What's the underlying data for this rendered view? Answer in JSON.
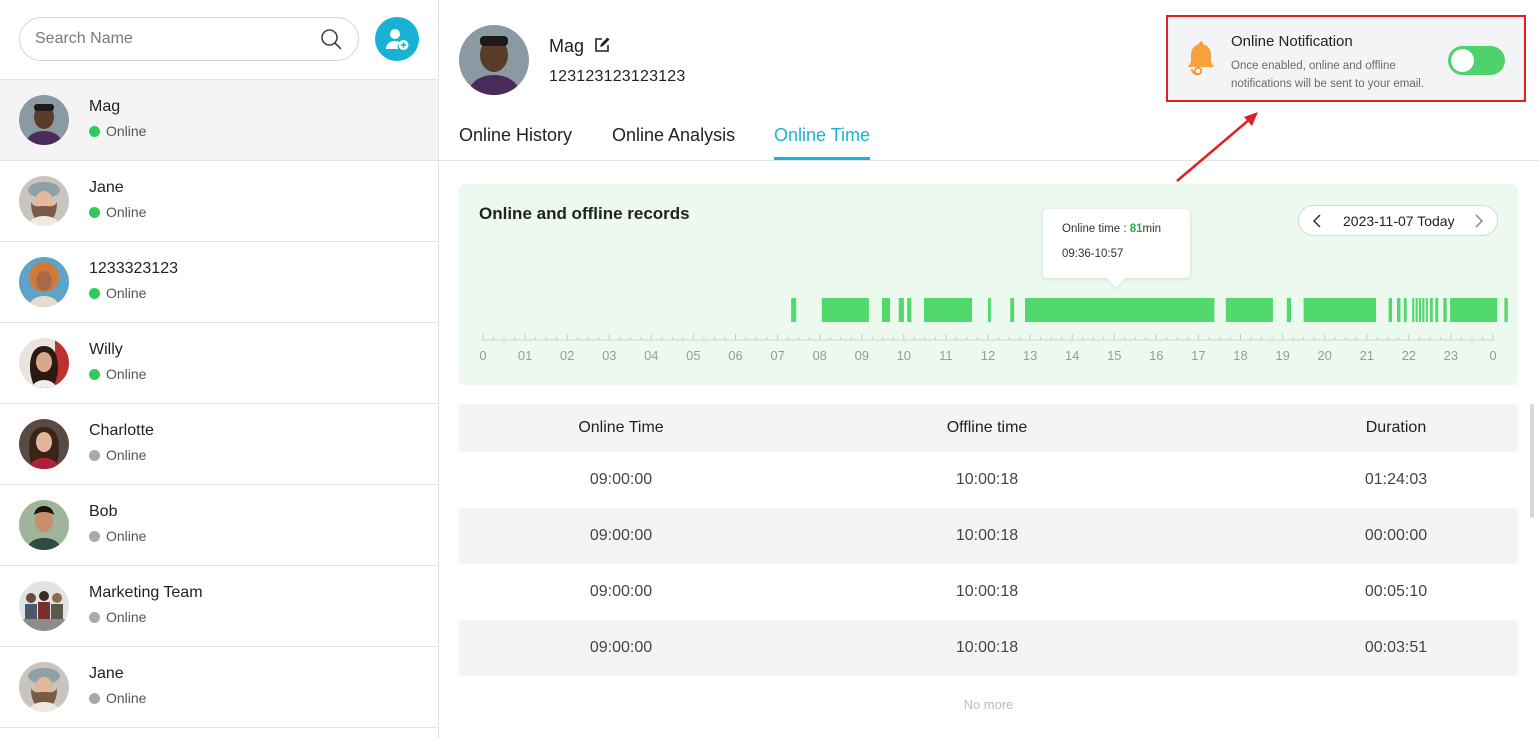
{
  "sidebar": {
    "search_placeholder": "Search Name",
    "contacts": [
      {
        "name": "Mag",
        "status": "Online",
        "online": true,
        "active": true
      },
      {
        "name": "Jane",
        "status": "Online",
        "online": true
      },
      {
        "name": "1233323123",
        "status": "Online",
        "online": true
      },
      {
        "name": "Willy",
        "status": "Online",
        "online": true
      },
      {
        "name": "Charlotte",
        "status": "Online",
        "online": false
      },
      {
        "name": "Bob",
        "status": "Online",
        "online": false
      },
      {
        "name": "Marketing Team",
        "status": "Online",
        "online": false
      },
      {
        "name": "Jane",
        "status": "Online",
        "online": false
      }
    ]
  },
  "profile": {
    "name": "Mag",
    "id": "123123123123123"
  },
  "notification": {
    "title": "Online Notification",
    "description": "Once enabled, online and offline notifications will be sent to your email.",
    "enabled": true
  },
  "tabs": [
    {
      "label": "Online History",
      "active": false
    },
    {
      "label": "Online Analysis",
      "active": false
    },
    {
      "label": "Online Time",
      "active": true
    }
  ],
  "records": {
    "title": "Online and offline records",
    "date": "2023-11-07 Today",
    "tooltip": {
      "label": "Online time : ",
      "value": "81",
      "unit": "min",
      "range": "09:36-10:57"
    },
    "hour_labels": [
      "0",
      "01",
      "02",
      "03",
      "04",
      "05",
      "06",
      "07",
      "08",
      "09",
      "10",
      "11",
      "12",
      "13",
      "14",
      "15",
      "16",
      "17",
      "18",
      "19",
      "20",
      "21",
      "22",
      "23",
      "0"
    ],
    "segments": [
      [
        7.32,
        7.44
      ],
      [
        8.05,
        9.17
      ],
      [
        9.48,
        9.67
      ],
      [
        9.88,
        10.0
      ],
      [
        10.08,
        10.18
      ],
      [
        10.48,
        11.62
      ],
      [
        12.0,
        12.07
      ],
      [
        12.53,
        12.62
      ],
      [
        12.88,
        17.38
      ],
      [
        17.65,
        18.77
      ],
      [
        19.1,
        19.2
      ],
      [
        19.5,
        21.22
      ],
      [
        21.52,
        21.6
      ],
      [
        21.72,
        21.8
      ],
      [
        21.88,
        21.95
      ],
      [
        22.08,
        22.13
      ],
      [
        22.16,
        22.21
      ],
      [
        22.24,
        22.29
      ],
      [
        22.32,
        22.37
      ],
      [
        22.4,
        22.45
      ],
      [
        22.5,
        22.57
      ],
      [
        22.63,
        22.7
      ],
      [
        22.82,
        22.9
      ],
      [
        22.98,
        24.1
      ],
      [
        24.27,
        24.35
      ]
    ],
    "colors": {
      "bar": "#52d96c",
      "panel": "#ecf9ef"
    }
  },
  "table": {
    "headers": [
      "Online Time",
      "Offline time",
      "Duration"
    ],
    "rows": [
      [
        "09:00:00",
        "10:00:18",
        "01:24:03"
      ],
      [
        "09:00:00",
        "10:00:18",
        "00:00:00"
      ],
      [
        "09:00:00",
        "10:00:18",
        "00:05:10"
      ],
      [
        "09:00:00",
        "10:00:18",
        "00:03:51"
      ]
    ],
    "footer": "No more"
  },
  "icons": {
    "search": "search-icon",
    "add_user": "add-user-icon",
    "edit": "edit-icon",
    "bell": "bell-icon",
    "prev": "chevron-left-icon",
    "next": "chevron-right-icon"
  }
}
